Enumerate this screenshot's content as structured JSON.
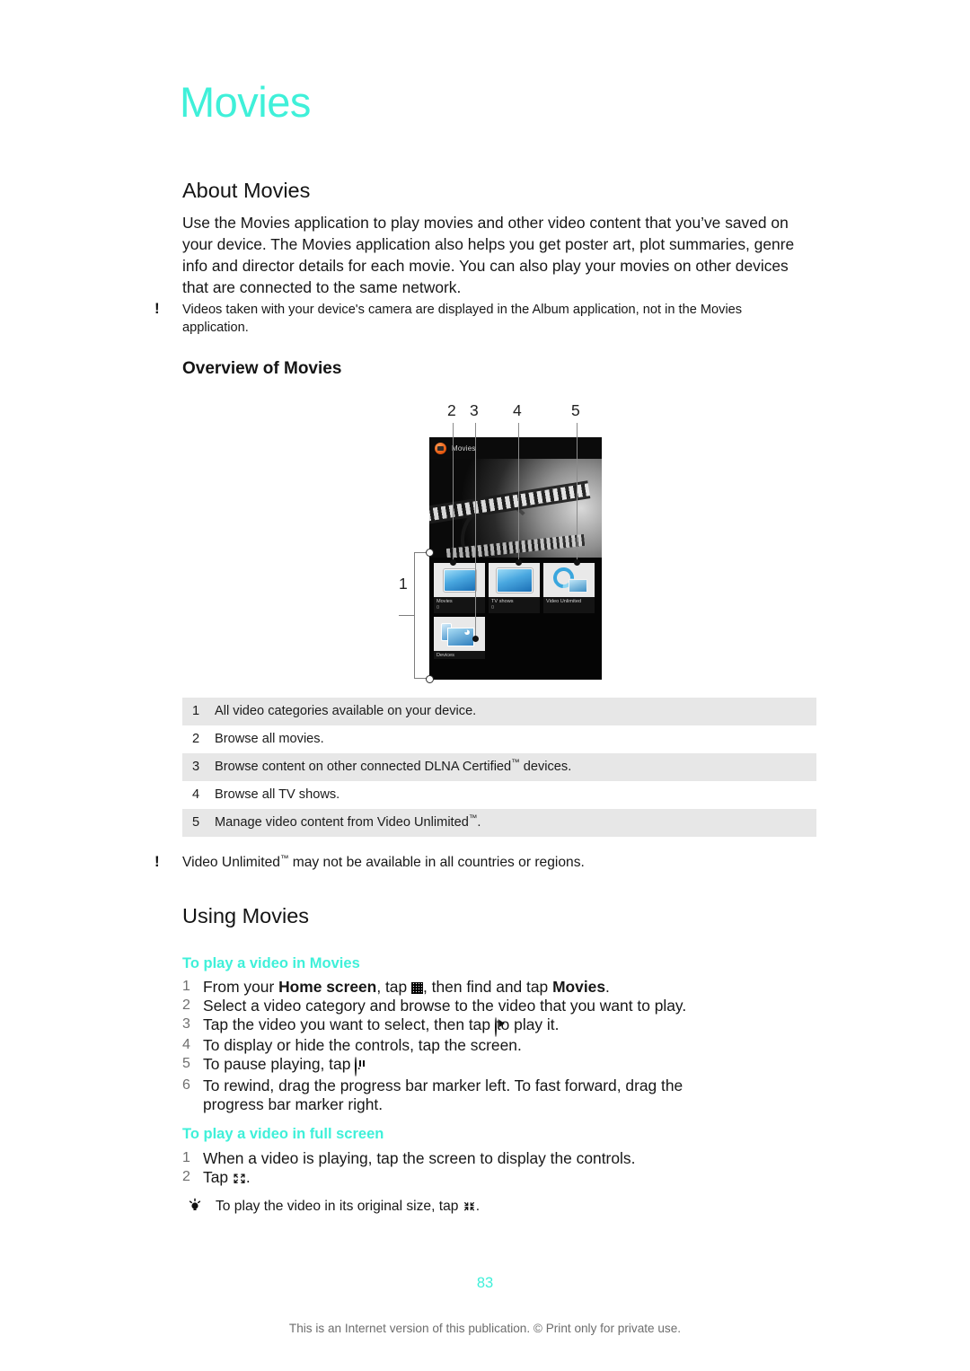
{
  "chapter": {
    "title": "Movies"
  },
  "about": {
    "heading": "About Movies",
    "paragraph": "Use the Movies application to play movies and other video content that you’ve saved on your device. The Movies application also helps you get poster art, plot summaries, genre info and director details for each movie. You can also play your movies on other devices that are connected to the same network.",
    "note": "Videos taken with your device's camera are displayed in the Album application, not in the Movies application."
  },
  "overview": {
    "heading": "Overview of Movies",
    "callouts": [
      "1",
      "2",
      "3",
      "4",
      "5"
    ],
    "device": {
      "app_title": "Movies",
      "tiles": [
        {
          "label": "Movies",
          "sublabel": "0"
        },
        {
          "label": "TV shows",
          "sublabel": "0"
        },
        {
          "label": "Video Unlimited",
          "sublabel": ""
        },
        {
          "label": "Devices",
          "sublabel": ""
        }
      ]
    },
    "legend": [
      {
        "num": "1",
        "text": "All video categories available on your device."
      },
      {
        "num": "2",
        "text": "Browse all movies."
      },
      {
        "num": "3",
        "text": "Browse content on other connected DLNA Certified™ devices."
      },
      {
        "num": "4",
        "text": "Browse all TV shows."
      },
      {
        "num": "5",
        "text": "Manage video content from Video Unlimited™."
      }
    ],
    "note": "Video Unlimited™ may not be available in all countries or regions."
  },
  "using": {
    "heading": "Using Movies",
    "play_in_movies": {
      "heading": "To play a video in Movies",
      "steps": [
        {
          "num": "1",
          "pre": "From your ",
          "bold": "Home screen",
          "mid": ", tap ",
          "icon": "apps-grid-icon",
          "post": ", then find and tap ",
          "bold2": "Movies",
          "end": "."
        },
        {
          "num": "2",
          "pre": "Select a video category and browse to the video that you want to play."
        },
        {
          "num": "3",
          "pre": "Tap the video you want to select, then tap ",
          "icon": "play-circle-icon",
          "post": " to play it."
        },
        {
          "num": "4",
          "pre": "To display or hide the controls, tap the screen."
        },
        {
          "num": "5",
          "pre": "To pause playing, tap ",
          "icon": "pause-circle-icon",
          "post": "."
        },
        {
          "num": "6",
          "pre": "To rewind, drag the progress bar marker left. To fast forward, drag the progress bar marker right."
        }
      ]
    },
    "play_full_screen": {
      "heading": "To play a video in full screen",
      "steps": [
        {
          "num": "1",
          "pre": "When a video is playing, tap the screen to display the controls."
        },
        {
          "num": "2",
          "pre": "Tap ",
          "icon": "expand-fullscreen-icon",
          "post": "."
        }
      ],
      "tip_pre": "To play the video in its original size, tap ",
      "tip_icon": "shrink-original-size-icon",
      "tip_post": "."
    }
  },
  "footer": {
    "page_number": "83",
    "notice": "This is an Internet version of this publication. © Print only for private use."
  },
  "colors": {
    "accent": "#3ff0d9",
    "row_shade": "#e7e7e7",
    "text": "#171717"
  }
}
